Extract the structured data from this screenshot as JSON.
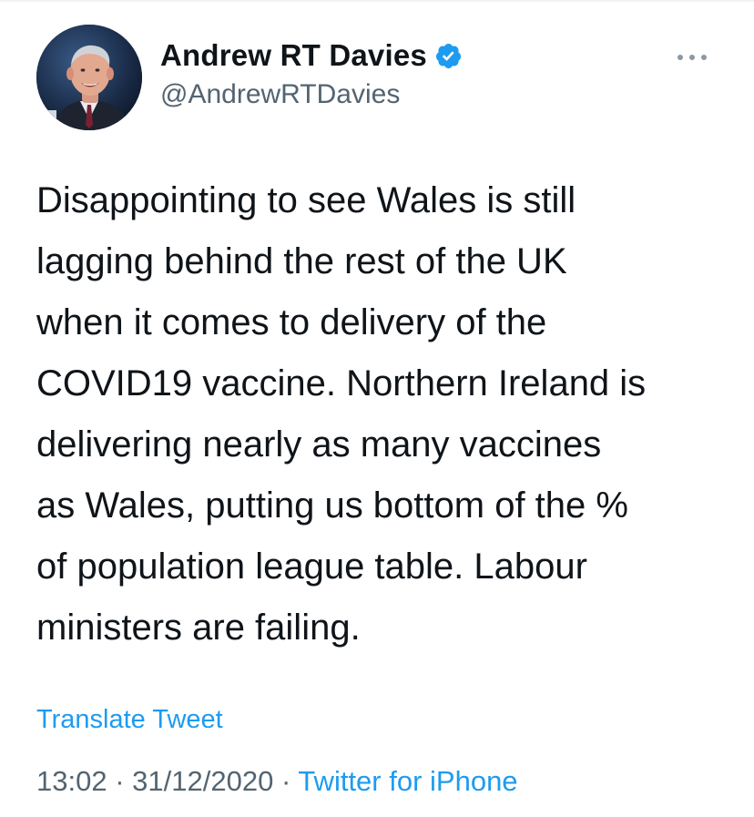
{
  "author": {
    "display_name": "Andrew RT Davies",
    "handle": "@AndrewRTDavies",
    "verified": true,
    "avatar_icon": "profile-photo",
    "verified_icon": "verified-badge-icon",
    "verified_color": "#1d9bf0"
  },
  "more_icon": "more-horizontal-icon",
  "tweet": {
    "text": "Disappointing to see Wales is still\nlagging behind the rest of the UK\nwhen it comes to delivery of the\nCOVID19 vaccine. Northern Ireland is\ndelivering nearly as many vaccines\nas Wales, putting us bottom of the %\nof population league table. Labour\nministers are failing."
  },
  "translate_label": "Translate Tweet",
  "meta": {
    "time": "13:02",
    "separator": "·",
    "date": "31/12/2020",
    "source": "Twitter for iPhone"
  },
  "colors": {
    "link": "#1d9bf0",
    "secondary_text": "#536471",
    "primary_text": "#0f1419"
  }
}
